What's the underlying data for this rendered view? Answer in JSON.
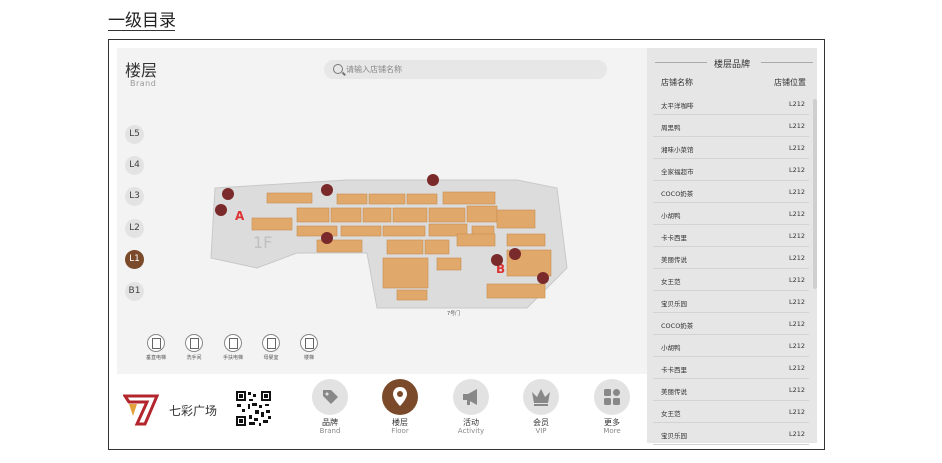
{
  "heading": "一级目录",
  "main": {
    "title": "楼层",
    "subtitle": "Brand",
    "search_placeholder": "请输入店铺名称",
    "floors": [
      {
        "label": "L5",
        "active": false
      },
      {
        "label": "L4",
        "active": false
      },
      {
        "label": "L3",
        "active": false
      },
      {
        "label": "L2",
        "active": false
      },
      {
        "label": "L1",
        "active": true
      },
      {
        "label": "B1",
        "active": false
      }
    ],
    "legend": [
      {
        "label": "垂直电梯",
        "icon": "elevator-icon"
      },
      {
        "label": "洗手间",
        "icon": "restroom-icon"
      },
      {
        "label": "手扶电梯",
        "icon": "escalator-icon"
      },
      {
        "label": "母婴室",
        "icon": "baby-room-icon"
      },
      {
        "label": "楼梯",
        "icon": "stairs-icon"
      }
    ],
    "map": {
      "floor_label": "1F",
      "zone_a": "A",
      "zone_b": "B",
      "gate_7": "7号门"
    }
  },
  "sidebar": {
    "title": "楼层品牌",
    "col_name": "店铺名称",
    "col_pos": "店铺位置",
    "rows": [
      {
        "name": "太平洋咖啡",
        "pos": "L212"
      },
      {
        "name": "周黑鸭",
        "pos": "L212"
      },
      {
        "name": "湘味小菜馆",
        "pos": "L212"
      },
      {
        "name": "全家福超市",
        "pos": "L212"
      },
      {
        "name": "COCO奶茶",
        "pos": "L212"
      },
      {
        "name": "小胡鸭",
        "pos": "L212"
      },
      {
        "name": "卡卡西里",
        "pos": "L212"
      },
      {
        "name": "美丽传说",
        "pos": "L212"
      },
      {
        "name": "女王范",
        "pos": "L212"
      },
      {
        "name": "宝贝乐园",
        "pos": "L212"
      },
      {
        "name": "COCO奶茶",
        "pos": "L212"
      },
      {
        "name": "小胡鸭",
        "pos": "L212"
      },
      {
        "name": "卡卡西里",
        "pos": "L212"
      },
      {
        "name": "美丽传说",
        "pos": "L212"
      },
      {
        "name": "女王范",
        "pos": "L212"
      },
      {
        "name": "宝贝乐园",
        "pos": "L212"
      }
    ]
  },
  "bottom": {
    "brand_name": "七彩广场",
    "nav": [
      {
        "label": "品牌",
        "sub": "Brand",
        "icon": "tag-icon",
        "active": false
      },
      {
        "label": "楼层",
        "sub": "Floor",
        "icon": "location-pin-icon",
        "active": true
      },
      {
        "label": "活动",
        "sub": "Activity",
        "icon": "megaphone-icon",
        "active": false
      },
      {
        "label": "会员",
        "sub": "VIP",
        "icon": "crown-icon",
        "active": false
      },
      {
        "label": "更多",
        "sub": "More",
        "icon": "grid-icon",
        "active": false
      }
    ]
  },
  "colors": {
    "accent": "#7a4a2a",
    "shop": "#e0a86a",
    "sidebar_bg": "#e6e6e6"
  }
}
